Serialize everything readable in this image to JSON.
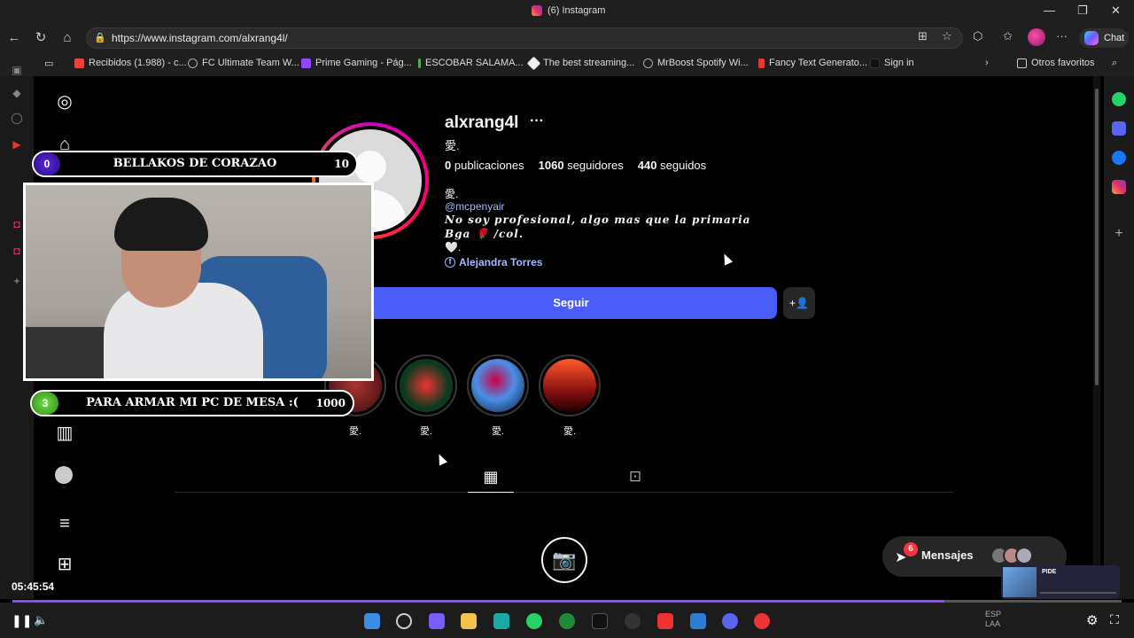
{
  "window": {
    "title": "(6) Instagram"
  },
  "address": {
    "url": "https://www.instagram.com/alxrang4l/"
  },
  "chat_button": {
    "label": "Chat"
  },
  "bookmarks": [
    {
      "label": "Recibidos (1.988) - c..."
    },
    {
      "label": "FC Ultimate Team W..."
    },
    {
      "label": "Prime Gaming - Pág..."
    },
    {
      "label": "ESCOBAR SALAMA..."
    },
    {
      "label": "The best streaming..."
    },
    {
      "label": "MrBoost Spotify Wi..."
    },
    {
      "label": "Fancy Text Generato..."
    },
    {
      "label": "Sign in"
    }
  ],
  "bookmarks_other": "Otros favoritos",
  "profile": {
    "username": "alxrang4l",
    "more": "···",
    "name_glyph": "愛.",
    "stats": {
      "posts_count": "0",
      "posts_label": "publicaciones",
      "followers_count": "1060",
      "followers_label": "seguidores",
      "following_count": "440",
      "following_label": "seguidos"
    },
    "bio": {
      "line1": "愛.",
      "mention": "@mcpenyair",
      "line3": "𝑵𝒐 𝒔𝒐𝒚 𝒑𝒓𝒐𝒇𝒆𝒔𝒊𝒐𝒏𝒂𝒍, 𝒂𝒍𝒈𝒐 𝒎𝒂𝒔 𝒒𝒖𝒆 𝒍𝒂 𝒑𝒓𝒊𝒎𝒂𝒓𝒊𝒂",
      "line4": "𝑩𝒈𝒂 🌹 /𝒄𝒐𝒍.",
      "line5": "🤍.",
      "fb_link": "Alejandra Torres"
    },
    "follow_label": "Seguir",
    "suggest_icon": "+👤"
  },
  "highlights": [
    {
      "label": "愛.",
      "color": "#6b1a1a"
    },
    {
      "label": "愛.",
      "color": "#1f6b3a"
    },
    {
      "label": "愛.",
      "color": "#2a4f8c"
    },
    {
      "label": "愛.",
      "color": "#b8431c"
    }
  ],
  "tabs": {
    "grid_icon": "▦",
    "tagged_icon": "⊡"
  },
  "empty_icon": "📷",
  "messages": {
    "label": "Mensajes",
    "badge": "6"
  },
  "stream_overlay": {
    "goal_top": {
      "count": "0",
      "text": "BELLAKOS DE CORAZAO",
      "max": "10"
    },
    "goal_bottom": {
      "count": "3",
      "text": "PARA ARMAR MI PC DE MESA :(",
      "max": "1000"
    }
  },
  "player": {
    "time": "05:45:54",
    "progress_pct": 84
  },
  "mini_clip": {
    "title": "PIDE"
  },
  "tray": {
    "lang": "ESP",
    "lang2": "LAA"
  },
  "colors": {
    "accent_follow": "#4a5df9",
    "stream_progress": "#9147ff"
  }
}
